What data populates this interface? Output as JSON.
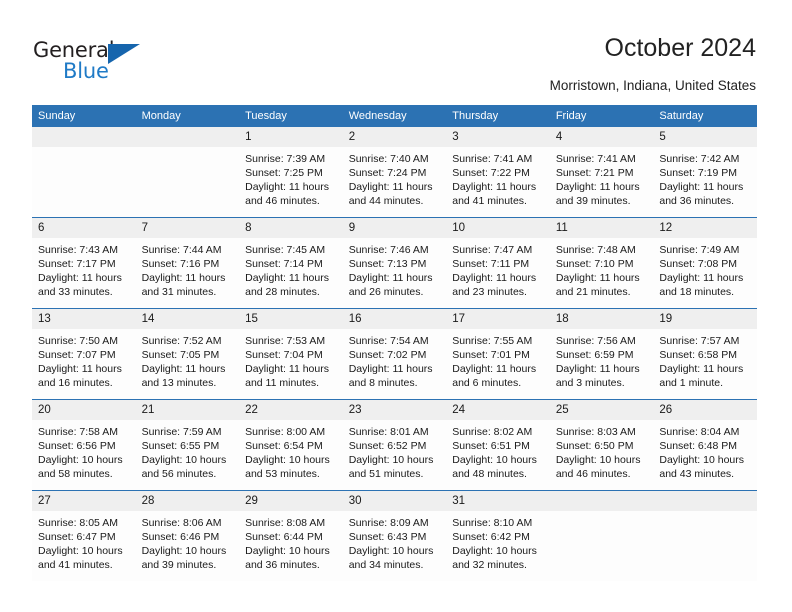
{
  "brand": {
    "name_part1": "General",
    "name_part2": "Blue",
    "accent_color": "#1f7ac6",
    "triangle_color": "#1665ad",
    "logo_icon": "triangle-logo-icon"
  },
  "header": {
    "title": "October 2024",
    "subtitle": "Morristown, Indiana, United States"
  },
  "theme": {
    "header_row_color": "#2c72b3",
    "daynum_band_color": "#efefef",
    "text_color": "#1a1a1a"
  },
  "weekday_headers": [
    "Sunday",
    "Monday",
    "Tuesday",
    "Wednesday",
    "Thursday",
    "Friday",
    "Saturday"
  ],
  "weeks": [
    {
      "days": [
        {
          "num": "",
          "sunrise": "",
          "sunset": "",
          "daylight": "",
          "blank": true
        },
        {
          "num": "",
          "sunrise": "",
          "sunset": "",
          "daylight": "",
          "blank": true
        },
        {
          "num": "1",
          "sunrise": "Sunrise: 7:39 AM",
          "sunset": "Sunset: 7:25 PM",
          "daylight": "Daylight: 11 hours and 46 minutes."
        },
        {
          "num": "2",
          "sunrise": "Sunrise: 7:40 AM",
          "sunset": "Sunset: 7:24 PM",
          "daylight": "Daylight: 11 hours and 44 minutes."
        },
        {
          "num": "3",
          "sunrise": "Sunrise: 7:41 AM",
          "sunset": "Sunset: 7:22 PM",
          "daylight": "Daylight: 11 hours and 41 minutes."
        },
        {
          "num": "4",
          "sunrise": "Sunrise: 7:41 AM",
          "sunset": "Sunset: 7:21 PM",
          "daylight": "Daylight: 11 hours and 39 minutes."
        },
        {
          "num": "5",
          "sunrise": "Sunrise: 7:42 AM",
          "sunset": "Sunset: 7:19 PM",
          "daylight": "Daylight: 11 hours and 36 minutes."
        }
      ]
    },
    {
      "days": [
        {
          "num": "6",
          "sunrise": "Sunrise: 7:43 AM",
          "sunset": "Sunset: 7:17 PM",
          "daylight": "Daylight: 11 hours and 33 minutes."
        },
        {
          "num": "7",
          "sunrise": "Sunrise: 7:44 AM",
          "sunset": "Sunset: 7:16 PM",
          "daylight": "Daylight: 11 hours and 31 minutes."
        },
        {
          "num": "8",
          "sunrise": "Sunrise: 7:45 AM",
          "sunset": "Sunset: 7:14 PM",
          "daylight": "Daylight: 11 hours and 28 minutes."
        },
        {
          "num": "9",
          "sunrise": "Sunrise: 7:46 AM",
          "sunset": "Sunset: 7:13 PM",
          "daylight": "Daylight: 11 hours and 26 minutes."
        },
        {
          "num": "10",
          "sunrise": "Sunrise: 7:47 AM",
          "sunset": "Sunset: 7:11 PM",
          "daylight": "Daylight: 11 hours and 23 minutes."
        },
        {
          "num": "11",
          "sunrise": "Sunrise: 7:48 AM",
          "sunset": "Sunset: 7:10 PM",
          "daylight": "Daylight: 11 hours and 21 minutes."
        },
        {
          "num": "12",
          "sunrise": "Sunrise: 7:49 AM",
          "sunset": "Sunset: 7:08 PM",
          "daylight": "Daylight: 11 hours and 18 minutes."
        }
      ]
    },
    {
      "days": [
        {
          "num": "13",
          "sunrise": "Sunrise: 7:50 AM",
          "sunset": "Sunset: 7:07 PM",
          "daylight": "Daylight: 11 hours and 16 minutes."
        },
        {
          "num": "14",
          "sunrise": "Sunrise: 7:52 AM",
          "sunset": "Sunset: 7:05 PM",
          "daylight": "Daylight: 11 hours and 13 minutes."
        },
        {
          "num": "15",
          "sunrise": "Sunrise: 7:53 AM",
          "sunset": "Sunset: 7:04 PM",
          "daylight": "Daylight: 11 hours and 11 minutes."
        },
        {
          "num": "16",
          "sunrise": "Sunrise: 7:54 AM",
          "sunset": "Sunset: 7:02 PM",
          "daylight": "Daylight: 11 hours and 8 minutes."
        },
        {
          "num": "17",
          "sunrise": "Sunrise: 7:55 AM",
          "sunset": "Sunset: 7:01 PM",
          "daylight": "Daylight: 11 hours and 6 minutes."
        },
        {
          "num": "18",
          "sunrise": "Sunrise: 7:56 AM",
          "sunset": "Sunset: 6:59 PM",
          "daylight": "Daylight: 11 hours and 3 minutes."
        },
        {
          "num": "19",
          "sunrise": "Sunrise: 7:57 AM",
          "sunset": "Sunset: 6:58 PM",
          "daylight": "Daylight: 11 hours and 1 minute."
        }
      ]
    },
    {
      "days": [
        {
          "num": "20",
          "sunrise": "Sunrise: 7:58 AM",
          "sunset": "Sunset: 6:56 PM",
          "daylight": "Daylight: 10 hours and 58 minutes."
        },
        {
          "num": "21",
          "sunrise": "Sunrise: 7:59 AM",
          "sunset": "Sunset: 6:55 PM",
          "daylight": "Daylight: 10 hours and 56 minutes."
        },
        {
          "num": "22",
          "sunrise": "Sunrise: 8:00 AM",
          "sunset": "Sunset: 6:54 PM",
          "daylight": "Daylight: 10 hours and 53 minutes."
        },
        {
          "num": "23",
          "sunrise": "Sunrise: 8:01 AM",
          "sunset": "Sunset: 6:52 PM",
          "daylight": "Daylight: 10 hours and 51 minutes."
        },
        {
          "num": "24",
          "sunrise": "Sunrise: 8:02 AM",
          "sunset": "Sunset: 6:51 PM",
          "daylight": "Daylight: 10 hours and 48 minutes."
        },
        {
          "num": "25",
          "sunrise": "Sunrise: 8:03 AM",
          "sunset": "Sunset: 6:50 PM",
          "daylight": "Daylight: 10 hours and 46 minutes."
        },
        {
          "num": "26",
          "sunrise": "Sunrise: 8:04 AM",
          "sunset": "Sunset: 6:48 PM",
          "daylight": "Daylight: 10 hours and 43 minutes."
        }
      ]
    },
    {
      "days": [
        {
          "num": "27",
          "sunrise": "Sunrise: 8:05 AM",
          "sunset": "Sunset: 6:47 PM",
          "daylight": "Daylight: 10 hours and 41 minutes."
        },
        {
          "num": "28",
          "sunrise": "Sunrise: 8:06 AM",
          "sunset": "Sunset: 6:46 PM",
          "daylight": "Daylight: 10 hours and 39 minutes."
        },
        {
          "num": "29",
          "sunrise": "Sunrise: 8:08 AM",
          "sunset": "Sunset: 6:44 PM",
          "daylight": "Daylight: 10 hours and 36 minutes."
        },
        {
          "num": "30",
          "sunrise": "Sunrise: 8:09 AM",
          "sunset": "Sunset: 6:43 PM",
          "daylight": "Daylight: 10 hours and 34 minutes."
        },
        {
          "num": "31",
          "sunrise": "Sunrise: 8:10 AM",
          "sunset": "Sunset: 6:42 PM",
          "daylight": "Daylight: 10 hours and 32 minutes."
        },
        {
          "num": "",
          "sunrise": "",
          "sunset": "",
          "daylight": "",
          "blank": true
        },
        {
          "num": "",
          "sunrise": "",
          "sunset": "",
          "daylight": "",
          "blank": true
        }
      ]
    }
  ]
}
